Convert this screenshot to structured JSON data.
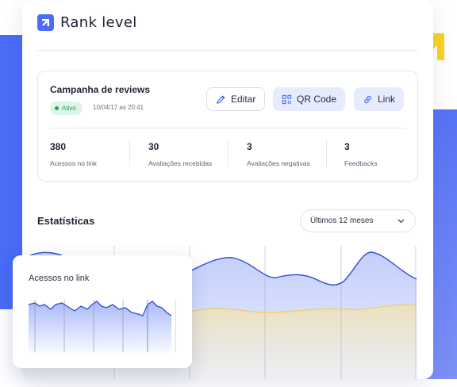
{
  "brand": {
    "name": "Rank level"
  },
  "campaign": {
    "title": "Campanha de reviews",
    "status": "Ativo",
    "date": "10/04/17 as 20:41",
    "buttons": {
      "edit": "Editar",
      "qr": "QR Code",
      "link": "Link"
    },
    "stats": [
      {
        "value": "380",
        "label": "Acessos no link"
      },
      {
        "value": "30",
        "label": "Avaliações recebidas"
      },
      {
        "value": "3",
        "label": "Avaliações negativas"
      },
      {
        "value": "3",
        "label": "Feedbacks"
      }
    ]
  },
  "statistics": {
    "title": "Estatísticas",
    "period": "Últimos 12 meses"
  },
  "mini_card": {
    "title": "Acessos no link"
  },
  "colors": {
    "accent": "#4a6cf7",
    "line_blue": "#2f4fd8",
    "line_yellow": "#f0cf6a",
    "logo_yellow": "#ffd21f",
    "active_green": "#27a05a"
  },
  "icons": {
    "edit": "pencil-icon",
    "qr": "qr-code-icon",
    "link": "link-icon",
    "period": "chevron-down-icon"
  }
}
